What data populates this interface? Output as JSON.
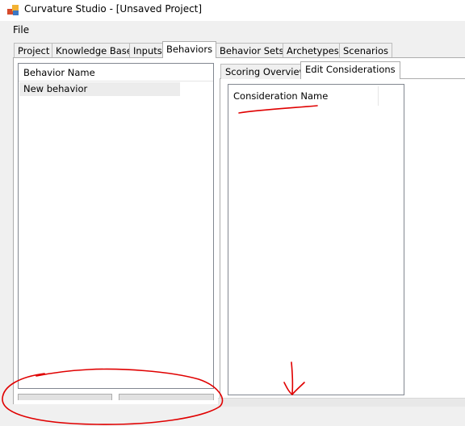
{
  "window": {
    "title": "Curvature Studio - [Unsaved Project]",
    "icon": "app-window-icon"
  },
  "menu": {
    "file_label": "File"
  },
  "tabs": [
    {
      "label": "Project",
      "active": false
    },
    {
      "label": "Knowledge Base",
      "active": false
    },
    {
      "label": "Inputs",
      "active": false
    },
    {
      "label": "Behaviors",
      "active": true
    },
    {
      "label": "Behavior Sets",
      "active": false
    },
    {
      "label": "Archetypes",
      "active": false
    },
    {
      "label": "Scenarios",
      "active": false
    }
  ],
  "behaviors_list": {
    "header": "Behavior Name",
    "items": [
      "New behavior"
    ]
  },
  "subtabs": [
    {
      "label": "Scoring Overview",
      "active": false
    },
    {
      "label": "Edit Considerations",
      "active": true
    }
  ],
  "considerations_list": {
    "header": "Consideration Name"
  },
  "annotation": {
    "color": "#e00000"
  }
}
